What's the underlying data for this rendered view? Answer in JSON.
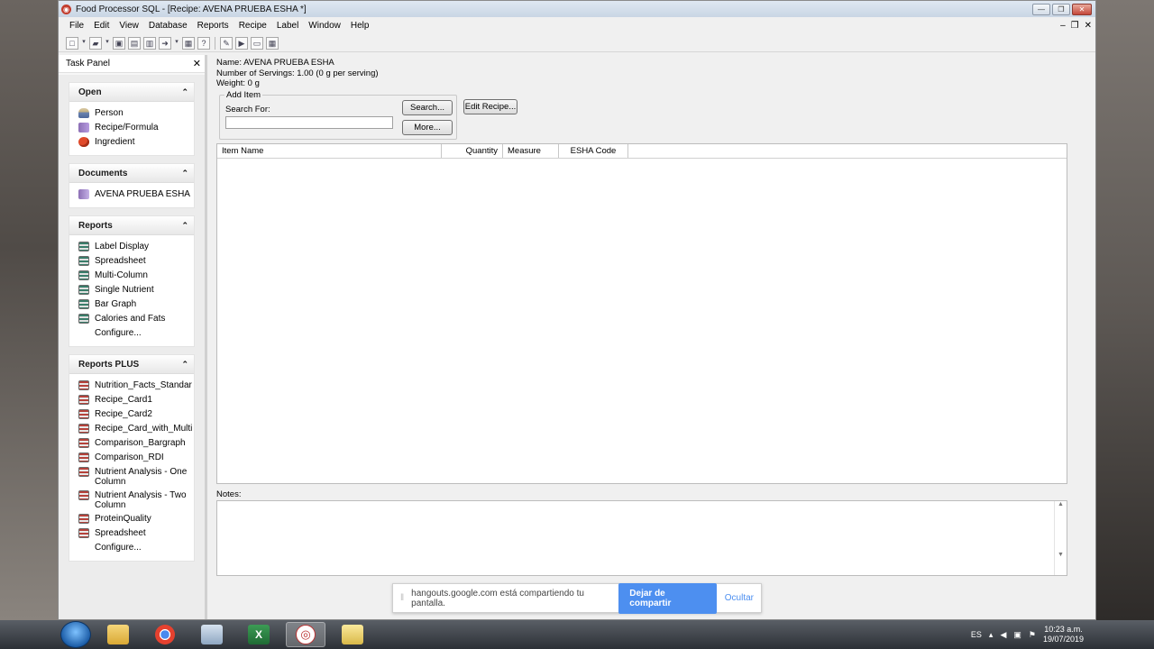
{
  "window": {
    "title": "Food Processor SQL - [Recipe: AVENA PRUEBA ESHA *]",
    "controls": {
      "minimize": "—",
      "restore": "❐",
      "close": "✕"
    }
  },
  "menu": [
    "File",
    "Edit",
    "View",
    "Database",
    "Reports",
    "Recipe",
    "Label",
    "Window",
    "Help"
  ],
  "mdi_controls": {
    "minimize": "–",
    "restore": "❐",
    "close": "✕"
  },
  "task_panel": {
    "title": "Task Panel",
    "close": "✕",
    "sections": [
      {
        "title": "Open",
        "collapse": "⌃",
        "items": [
          {
            "label": "Person",
            "icon": "person-icon"
          },
          {
            "label": "Recipe/Formula",
            "icon": "recipe-icon"
          },
          {
            "label": "Ingredient",
            "icon": "ingredient-icon"
          }
        ]
      },
      {
        "title": "Documents",
        "collapse": "⌃",
        "items": [
          {
            "label": "AVENA PRUEBA ESHA",
            "icon": "document-icon"
          }
        ]
      },
      {
        "title": "Reports",
        "collapse": "⌃",
        "items": [
          {
            "label": "Label Display",
            "icon": "report-icon"
          },
          {
            "label": "Spreadsheet",
            "icon": "report-icon"
          },
          {
            "label": "Multi-Column",
            "icon": "report-icon"
          },
          {
            "label": "Single Nutrient",
            "icon": "report-icon"
          },
          {
            "label": "Bar Graph",
            "icon": "report-icon"
          },
          {
            "label": "Calories and Fats",
            "icon": "report-icon"
          },
          {
            "label": "Configure...",
            "icon": ""
          }
        ]
      },
      {
        "title": "Reports PLUS",
        "collapse": "⌃",
        "items": [
          {
            "label": "Nutrition_Facts_Standar",
            "icon": "report-plus-icon"
          },
          {
            "label": "Recipe_Card1",
            "icon": "report-plus-icon"
          },
          {
            "label": "Recipe_Card2",
            "icon": "report-plus-icon"
          },
          {
            "label": "Recipe_Card_with_Multi",
            "icon": "report-plus-icon"
          },
          {
            "label": "Comparison_Bargraph",
            "icon": "report-plus-icon"
          },
          {
            "label": "Comparison_RDI",
            "icon": "report-plus-icon"
          },
          {
            "label": "Nutrient Analysis - One Column",
            "icon": "report-plus-icon"
          },
          {
            "label": "Nutrient Analysis - Two Column",
            "icon": "report-plus-icon"
          },
          {
            "label": "ProteinQuality",
            "icon": "report-plus-icon"
          },
          {
            "label": "Spreadsheet",
            "icon": "report-plus-icon"
          },
          {
            "label": "Configure...",
            "icon": ""
          }
        ]
      }
    ]
  },
  "recipe": {
    "name_line": "Name:  AVENA PRUEBA ESHA",
    "servings_line": "Number of Servings: 1.00  (0 g per serving)",
    "weight_line": "Weight: 0 g"
  },
  "add_item": {
    "legend": "Add Item",
    "search_label": "Search For:",
    "search_value": "",
    "search_button": "Search...",
    "more_button": "More...",
    "edit_recipe_button": "Edit Recipe..."
  },
  "grid": {
    "columns": [
      "Item Name",
      "Quantity",
      "Measure",
      "ESHA Code"
    ],
    "rows": []
  },
  "notes": {
    "label": "Notes:",
    "value": ""
  },
  "share_banner": {
    "message": "hangouts.google.com está compartiendo tu pantalla.",
    "stop_button": "Dejar de compartir",
    "hide_link": "Ocultar"
  },
  "taskbar": {
    "language": "ES",
    "time": "10:23 a.m.",
    "date": "19/07/2019"
  }
}
